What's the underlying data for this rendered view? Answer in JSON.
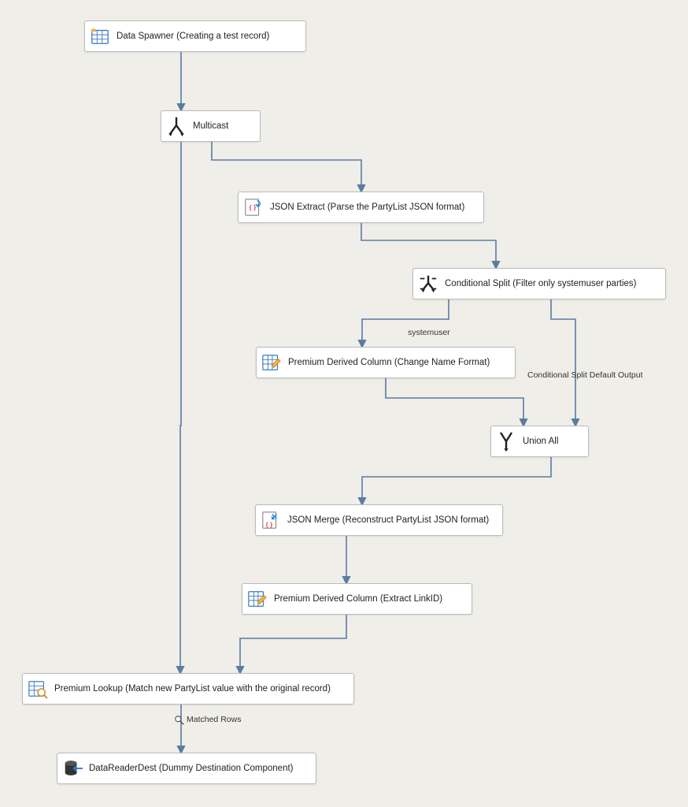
{
  "nodes": {
    "data_spawner": {
      "label": "Data Spawner (Creating a test record)"
    },
    "multicast": {
      "label": "Multicast"
    },
    "json_extract": {
      "label": "JSON Extract (Parse the PartyList JSON format)"
    },
    "cond_split": {
      "label": "Conditional Split (Filter only systemuser parties)"
    },
    "derived_change": {
      "label": "Premium Derived Column (Change Name Format)"
    },
    "union_all": {
      "label": "Union All"
    },
    "json_merge": {
      "label": "JSON Merge (Reconstruct PartyList JSON format)"
    },
    "derived_linkid": {
      "label": "Premium Derived Column (Extract LinkID)"
    },
    "premium_lookup": {
      "label": "Premium Lookup (Match new PartyList value with the original record)"
    },
    "datareader_dest": {
      "label": "DataReaderDest  (Dummy Destination Component)"
    }
  },
  "edge_labels": {
    "systemuser": "systemuser",
    "default_out": "Conditional Split Default Output",
    "matched_rows": "Matched Rows"
  }
}
